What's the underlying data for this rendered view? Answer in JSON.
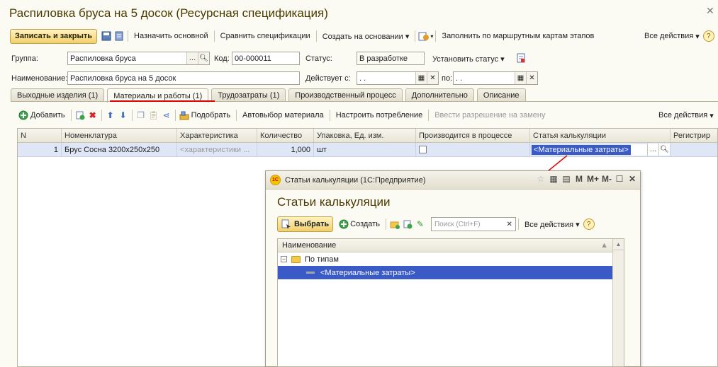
{
  "window": {
    "title": "Распиловка бруса на 5 досок (Ресурсная спецификация)"
  },
  "toolbar": {
    "save_close": "Записать и закрыть",
    "set_main": "Назначить основной",
    "compare": "Сравнить спецификации",
    "create_based": "Создать на основании",
    "fill_routes": "Заполнить по маршрутным картам этапов",
    "all_actions": "Все действия"
  },
  "form": {
    "group_label": "Группа:",
    "group_value": "Распиловка бруса",
    "code_label": "Код:",
    "code_value": "00-000011",
    "status_label": "Статус:",
    "status_value": "В разработке",
    "set_status": "Установить статус",
    "name_label": "Наименование:",
    "name_value": "Распиловка бруса на 5 досок",
    "valid_from_label": "Действует с:",
    "valid_from_value": " .  .",
    "to_label": "по:",
    "to_value": " .  ."
  },
  "tabs": [
    "Выходные изделия (1)",
    "Материалы и работы (1)",
    "Трудозатраты (1)",
    "Производственный процесс",
    "Дополнительно",
    "Описание"
  ],
  "subtoolbar": {
    "add": "Добавить",
    "pick": "Подобрать",
    "auto_pick": "Автовыбор материала",
    "set_consumption": "Настроить потребление",
    "allow_replacement": "Ввести разрешение на замену",
    "all_actions": "Все действия"
  },
  "table": {
    "headers": [
      "N",
      "Номенклатура",
      "Характеристика",
      "Количество",
      "Упаковка, Ед. изм.",
      "Производится в процессе",
      "Статья калькуляции",
      "Регистрир"
    ],
    "row": {
      "n": "1",
      "item": "Брус Сосна 3200х250х250",
      "characteristic": "<характеристики ...",
      "quantity": "1,000",
      "unit": "шт",
      "cost_item": "<Материальные затраты>"
    }
  },
  "dialog": {
    "window_title": "Статьи калькуляции  (1С:Предприятие)",
    "heading": "Статьи калькуляции",
    "select": "Выбрать",
    "create": "Создать",
    "search_placeholder": "Поиск (Ctrl+F)",
    "all_actions": "Все действия",
    "column": "Наименование",
    "tree": {
      "group": "По типам",
      "item": "<Материальные затраты>"
    },
    "tools": [
      "M",
      "M+",
      "M-"
    ]
  }
}
